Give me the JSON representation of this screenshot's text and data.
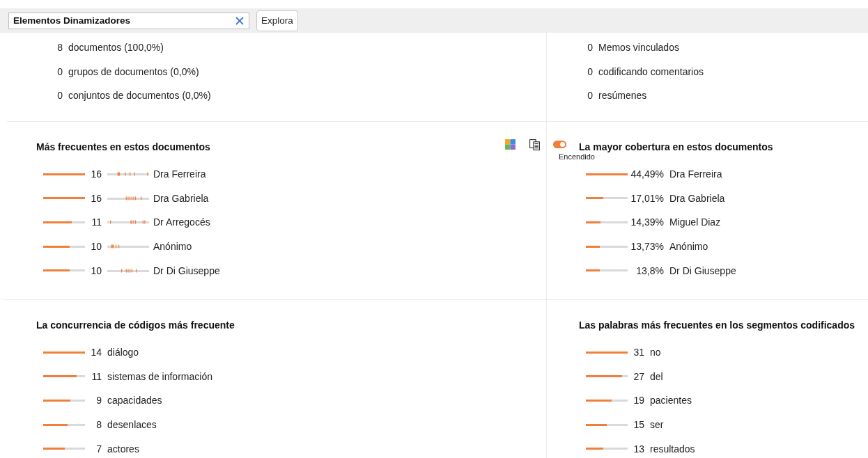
{
  "search": {
    "value": "Elementos Dinamizadores",
    "button": "Explora"
  },
  "summary_left": [
    {
      "count": "8",
      "label": "documentos (100,0%)"
    },
    {
      "count": "0",
      "label": "grupos de documentos (0,0%)"
    },
    {
      "count": "0",
      "label": "conjuntos de documentos (0,0%)"
    }
  ],
  "summary_right": [
    {
      "count": "0",
      "label": "Memos vinculados"
    },
    {
      "count": "0",
      "label": "codificando comentarios"
    },
    {
      "count": "0",
      "label": "resúmenes"
    }
  ],
  "toggle": {
    "label": "Encendido",
    "on": true
  },
  "sections": [
    {
      "title": "Más frecuentes en estos documentos",
      "kind": "distribution",
      "items": [
        {
          "value": "16",
          "label": "Dra Ferreira",
          "level": 1
        },
        {
          "value": "16",
          "label": "Dra Gabriela",
          "level": 1
        },
        {
          "value": "11",
          "label": "Dr Arregocés",
          "level": 0.69
        },
        {
          "value": "10",
          "label": "Anónimo",
          "level": 0.63
        },
        {
          "value": "10",
          "label": "Dr Di Giuseppe",
          "level": 0.63
        }
      ]
    },
    {
      "title": "La mayor cobertura en estos documentos",
      "kind": "plain",
      "items": [
        {
          "value": "44,49%",
          "label": "Dra Ferreira",
          "level": 1
        },
        {
          "value": "17,01%",
          "label": "Dra Gabriela",
          "level": 0.41
        },
        {
          "value": "14,39%",
          "label": "Miguel Diaz",
          "level": 0.35
        },
        {
          "value": "13,73%",
          "label": "Anónimo",
          "level": 0.33
        },
        {
          "value": "13,8%",
          "label": "Dr Di Giuseppe",
          "level": 0.33
        }
      ]
    },
    {
      "title": "La concurrencia de códigos más frecuente",
      "kind": "plain",
      "items": [
        {
          "value": "14",
          "label": "diálogo",
          "level": 1
        },
        {
          "value": "11",
          "label": "sistemas de información",
          "level": 0.8
        },
        {
          "value": "9",
          "label": "capacidades",
          "level": 0.65
        },
        {
          "value": "8",
          "label": "desenlaces",
          "level": 0.58
        },
        {
          "value": "7",
          "label": "actores",
          "level": 0.52
        }
      ]
    },
    {
      "title": "Las palabras más frecuentes en los segmentos codificados",
      "kind": "plain",
      "items": [
        {
          "value": "31",
          "label": "no",
          "level": 1
        },
        {
          "value": "27",
          "label": "del",
          "level": 0.87
        },
        {
          "value": "19",
          "label": "pacientes",
          "level": 0.62
        },
        {
          "value": "15",
          "label": "ser",
          "level": 0.5
        },
        {
          "value": "13",
          "label": "resultados",
          "level": 0.42
        }
      ]
    }
  ]
}
